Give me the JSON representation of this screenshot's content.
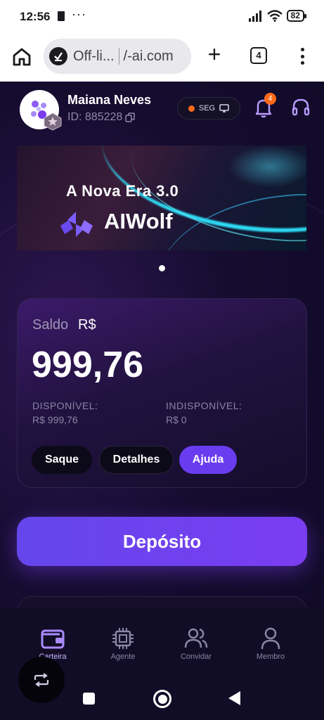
{
  "status_bar": {
    "time": "12:56",
    "more": "···",
    "battery": "82",
    "icons": [
      "sim-icon",
      "signal-icon",
      "wifi-icon",
      "battery-icon"
    ]
  },
  "browser": {
    "tab_title": "Off-li...",
    "domain": "/-ai.com",
    "tab_count": "4",
    "add_tab": "+",
    "icons": [
      "home-icon",
      "site-icon",
      "add-tab-icon",
      "tabs-icon",
      "menu-icon"
    ]
  },
  "header": {
    "user_name": "Maiana Neves",
    "user_id": "ID: 885228",
    "seg_label": "SEG",
    "notification_count": "4",
    "colors": {
      "status_dot": "#ff6a1a",
      "badge": "#ff6a1a"
    }
  },
  "banner": {
    "title": "A Nova Era 3.0",
    "brand": "AIWolf",
    "colors": {
      "glow": "#2fe6ff",
      "logo": "#7b5cff"
    }
  },
  "balance": {
    "label": "Saldo",
    "currency": "R$",
    "amount": "999,76",
    "available_label": "DISPONÍVEL:",
    "available_value": "R$ 999,76",
    "unavailable_label": "INDISPONÍVEL:",
    "unavailable_value": "R$ 0",
    "buttons": {
      "withdraw": "Saque",
      "details": "Detalhes",
      "help": "Ajuda"
    },
    "colors": {
      "help_button": "#6a3cf0"
    }
  },
  "deposit": {
    "label": "Depósito",
    "colors": {
      "gradient_start": "#6446ec",
      "gradient_end": "#7a3df0"
    }
  },
  "bottom_nav": {
    "items": [
      {
        "label": "Carteira",
        "icon": "wallet-icon",
        "active": true
      },
      {
        "label": "Agente",
        "icon": "chip-icon",
        "active": false
      },
      {
        "label": "Convidar",
        "icon": "users-icon",
        "active": false
      },
      {
        "label": "Membro",
        "icon": "user-icon",
        "active": false
      }
    ]
  },
  "floating_button": {
    "icon": "repeat-icon"
  },
  "system_nav": {
    "icons": [
      "recents-icon",
      "home-circle-icon",
      "back-icon"
    ]
  }
}
